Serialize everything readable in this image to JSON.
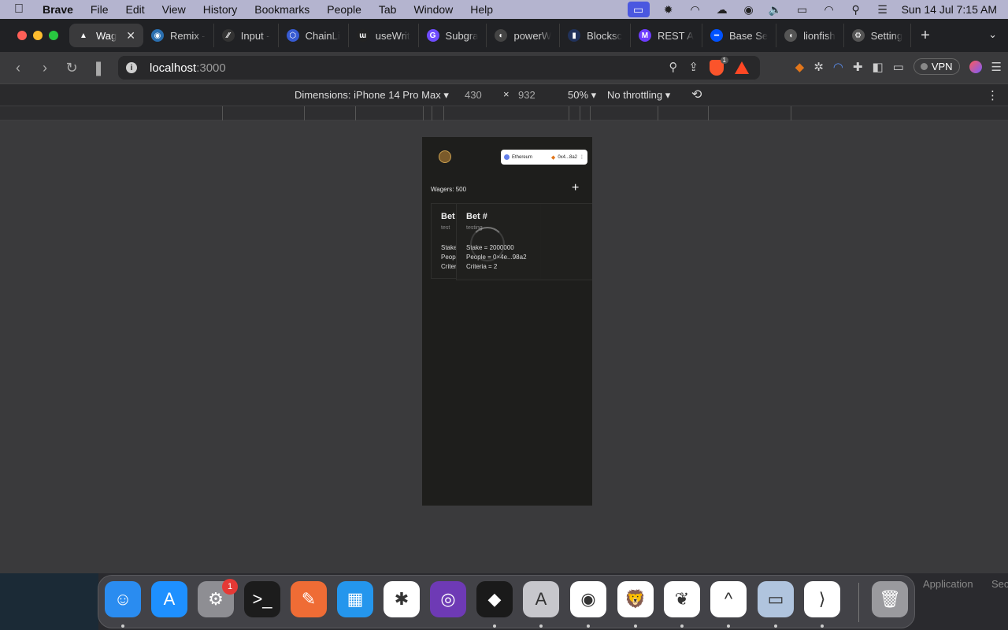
{
  "menubar": {
    "app_name": "Brave",
    "menus": [
      "File",
      "Edit",
      "View",
      "History",
      "Bookmarks",
      "People",
      "Tab",
      "Window",
      "Help"
    ],
    "clock": "Sun 14 Jul  7:15 AM"
  },
  "tabs": [
    {
      "label": "Wag",
      "active": true,
      "color": "#ffffff",
      "glyph": "▲"
    },
    {
      "label": "Remix -",
      "color": "#2a6fb0",
      "glyph": "◉"
    },
    {
      "label": "Input -",
      "color": "#333333",
      "glyph": "⁄⁄"
    },
    {
      "label": "ChainLi",
      "color": "#375bd2",
      "glyph": "⬡"
    },
    {
      "label": "useWrit",
      "color": "#222222",
      "glyph": "ɯ"
    },
    {
      "label": "Subgra",
      "color": "#6f4cff",
      "glyph": "G"
    },
    {
      "label": "powerW",
      "color": "#444444",
      "glyph": "◐"
    },
    {
      "label": "Blocksc",
      "color": "#21325b",
      "glyph": "▮"
    },
    {
      "label": "REST A",
      "color": "#6d3cff",
      "glyph": "M"
    },
    {
      "label": "Base Se",
      "color": "#0052ff",
      "glyph": "━"
    },
    {
      "label": "lionfish",
      "color": "#555555",
      "glyph": "◖"
    },
    {
      "label": "Setting",
      "color": "#555555",
      "glyph": "⚙"
    }
  ],
  "url": {
    "host": "localhost",
    "port": ":3000"
  },
  "vpn_label": "VPN",
  "devtools": {
    "dimensions_label": "Dimensions: iPhone 14 Pro Max ▾",
    "width": "430",
    "times": "×",
    "height": "932",
    "zoom": "50% ▾",
    "throttling": "No throttling ▾"
  },
  "app": {
    "network": "Ethereum",
    "address": "0x4...8a2",
    "wagers_label": "Wagers: 500",
    "add_symbol": "+",
    "card_back": {
      "title": "Bet",
      "desc": "test",
      "lines": [
        "Stake",
        "Peop",
        "Criter"
      ]
    },
    "card_front": {
      "title": "Bet #",
      "desc": "testing",
      "lines": [
        "Stake = 2000000",
        "People = 0×4e...98a2",
        "Criteria = 2"
      ]
    }
  },
  "dock": {
    "badge": "1",
    "behind_texts": [
      "Application",
      "Sec"
    ],
    "apps": [
      {
        "name": "Finder",
        "color": "#2a8cf0",
        "glyph": "☺"
      },
      {
        "name": "App Store",
        "color": "#1e90ff",
        "glyph": "A"
      },
      {
        "name": "System Settings",
        "color": "#8e8e93",
        "glyph": "⚙"
      },
      {
        "name": "Terminal",
        "color": "#1c1c1c",
        "glyph": ">_"
      },
      {
        "name": "Postman",
        "color": "#ef6c35",
        "glyph": "✎"
      },
      {
        "name": "Docker",
        "color": "#2496ed",
        "glyph": "▦"
      },
      {
        "name": "Slack",
        "color": "#ffffff",
        "glyph": "✱"
      },
      {
        "name": "Tor Browser",
        "color": "#6e3ab5",
        "glyph": "◎"
      },
      {
        "name": "Unity",
        "color": "#1a1a1a",
        "glyph": "◆"
      },
      {
        "name": "Affinity",
        "color": "#c7c7cc",
        "glyph": "A"
      },
      {
        "name": "Chrome",
        "color": "#ffffff",
        "glyph": "◉"
      },
      {
        "name": "Brave",
        "color": "#ffffff",
        "glyph": "🦁"
      },
      {
        "name": "MongoDB Compass",
        "color": "#ffffff",
        "glyph": "❦"
      },
      {
        "name": "Arc",
        "color": "#ffffff",
        "glyph": "^"
      },
      {
        "name": "Preview",
        "color": "#b0c4de",
        "glyph": "▭"
      },
      {
        "name": "VS Code",
        "color": "#ffffff",
        "glyph": "⟩"
      },
      {
        "name": "Trash",
        "color": "#9a9a9e",
        "glyph": "🗑"
      }
    ]
  }
}
